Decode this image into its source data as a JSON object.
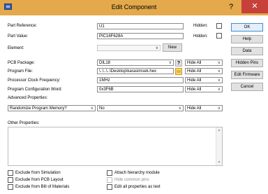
{
  "window": {
    "title": "Edit Component",
    "help_glyph": "?",
    "close_glyph": "✕",
    "titlebar_color": "#e3a94b"
  },
  "fields": {
    "part_reference": {
      "label": "Part Reference:",
      "value": "U1"
    },
    "part_value": {
      "label": "Part Value:",
      "value": "PIC16F628A"
    },
    "element": {
      "label": "Element:",
      "value": "",
      "new_label": "New"
    },
    "hidden_label": "Hidden:"
  },
  "properties": {
    "pcb_package": {
      "label": "PCB Package:",
      "value": "DIL18",
      "help": "?",
      "visibility": "Hide All"
    },
    "program_file": {
      "label": "Program File:",
      "value": "\\..\\..\\..\\Desktop\\karasimsek.hex",
      "visibility": "Hide All"
    },
    "clock_frequency": {
      "label": "Processor Clock Frequency:",
      "value": "1MHz",
      "visibility": "Hide All"
    },
    "config_word": {
      "label": "Program Configuration Word:",
      "value": "0x3F6B",
      "visibility": "Hide All"
    },
    "advanced_label": "Advanced Properties:",
    "advanced": {
      "name": "Randomize Program Memory?",
      "value": "No",
      "visibility": "Hide All"
    },
    "other_label": "Other Properties:"
  },
  "checkboxes": {
    "exclude_simulation": "Exclude from Simulation",
    "exclude_pcb": "Exclude from PCB Layout",
    "exclude_bom": "Exclude from Bill of Materials",
    "attach_hierarchy": "Attach hierarchy module",
    "hide_common_pins": "Hide common pins",
    "edit_all_text": "Edit all properties as text"
  },
  "buttons": {
    "ok": "OK",
    "help": "Help",
    "data": "Data",
    "hidden_pins": "Hidden Pins",
    "edit_firmware": "Edit Firmware",
    "cancel": "Cancel"
  }
}
